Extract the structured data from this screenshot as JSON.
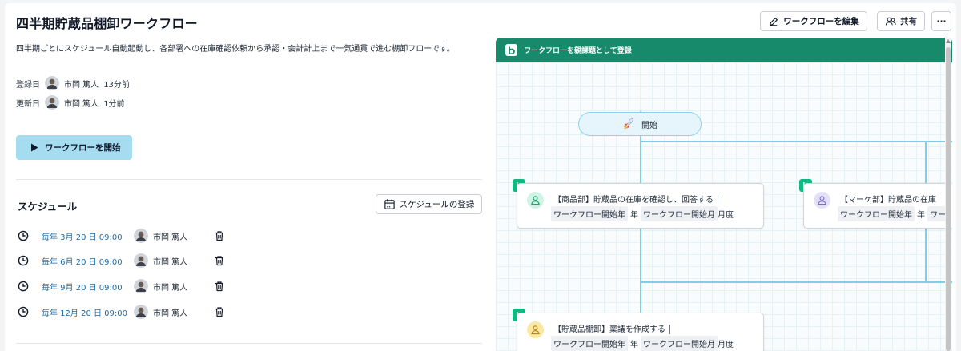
{
  "page": {
    "title": "四半期貯蔵品棚卸ワークフロー",
    "edit_label": "ワークフローを編集",
    "share_label": "共有",
    "more_label": "···"
  },
  "info": {
    "description": "四半期ごとにスケジュール自動起動し、各部署への在庫確認依頼から承認・会計計上まで一気通貫で進む棚卸フローです。",
    "registered_label": "登録日",
    "registered_user": "市岡 篤人",
    "registered_time": "13分前",
    "updated_label": "更新日",
    "updated_user": "市岡 篤人",
    "updated_time": "1分前",
    "start_label": "ワークフローを開始"
  },
  "schedule": {
    "title": "スケジュール",
    "register_label": "スケジュールの登録",
    "items": [
      {
        "when": "毎年 3月 20 日 09:00",
        "user": "市岡 篤人"
      },
      {
        "when": "毎年 6月 20 日 09:00",
        "user": "市岡 篤人"
      },
      {
        "when": "毎年 9月 20 日 09:00",
        "user": "市岡 篤人"
      },
      {
        "when": "毎年 12月 20 日 09:00",
        "user": "市岡 篤人"
      }
    ]
  },
  "flow": {
    "header": "ワークフローを親課題として登録",
    "start_node": "開始",
    "nodes": [
      {
        "title": "【商品部】貯蔵品の在庫を確認し、回答する",
        "year_chip": "ワークフロー開始年",
        "year_sep": "年",
        "month_chip": "ワークフロー開始月",
        "month_suffix": "月度",
        "color": "#d1f2e4",
        "icon_color": "#1d9e6e"
      },
      {
        "title": "【マーケ部】貯蔵品の在庫",
        "year_chip": "ワークフロー開始年",
        "year_sep": "年",
        "month_chip": "ワー",
        "month_suffix": "",
        "color": "#e4e0f7",
        "icon_color": "#7b6cc9"
      },
      {
        "title": "【貯蔵品棚卸】稟議を作成する",
        "year_chip": "ワークフロー開始年",
        "year_sep": "年",
        "month_chip": "ワークフロー開始月",
        "month_suffix": "月度",
        "color": "#fbe7a6",
        "icon_color": "#b58b12"
      }
    ]
  },
  "colors": {
    "accent_green": "#168a6a",
    "start_button": "#a5dcf0",
    "link_blue": "#1c6aa6",
    "connector": "#7dcfe6"
  }
}
